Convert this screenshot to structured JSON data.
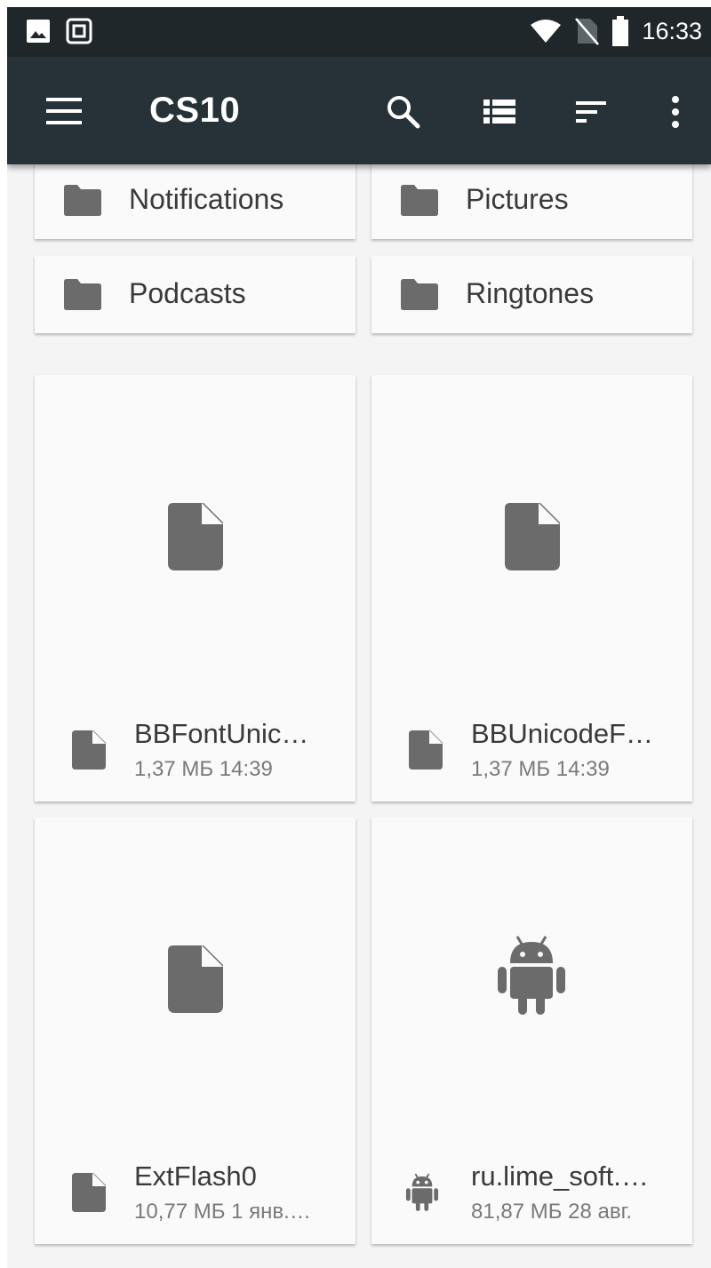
{
  "status_bar": {
    "time": "16:33",
    "icons": [
      "image-notification-icon",
      "screenshot-notification-icon",
      "wifi-icon",
      "no-sim-icon",
      "battery-icon"
    ]
  },
  "toolbar": {
    "title": "CS10",
    "icons": [
      "menu-icon",
      "search-icon",
      "list-view-icon",
      "sort-icon",
      "more-vert-icon"
    ],
    "background": "#263238"
  },
  "folders": [
    {
      "name": "Notifications"
    },
    {
      "name": "Pictures"
    },
    {
      "name": "Podcasts"
    },
    {
      "name": "Ringtones"
    }
  ],
  "files": [
    {
      "name": "BBFontUnic…",
      "meta": "1,37 МБ 14:39",
      "icon": "file-icon"
    },
    {
      "name": "BBUnicodeF…",
      "meta": "1,37 МБ 14:39",
      "icon": "file-icon"
    },
    {
      "name": "ExtFlash0",
      "meta": "10,77 МБ 1 янв.…",
      "icon": "file-icon"
    },
    {
      "name": "ru.lime_soft.…",
      "meta": "81,87 МБ 28 авг.",
      "icon": "android-icon"
    }
  ],
  "colors": {
    "status_bar": "#1f272a",
    "icon_gray": "#6b6b6b",
    "card_bg": "#fafafa",
    "page_bg": "#f4f4f4"
  }
}
